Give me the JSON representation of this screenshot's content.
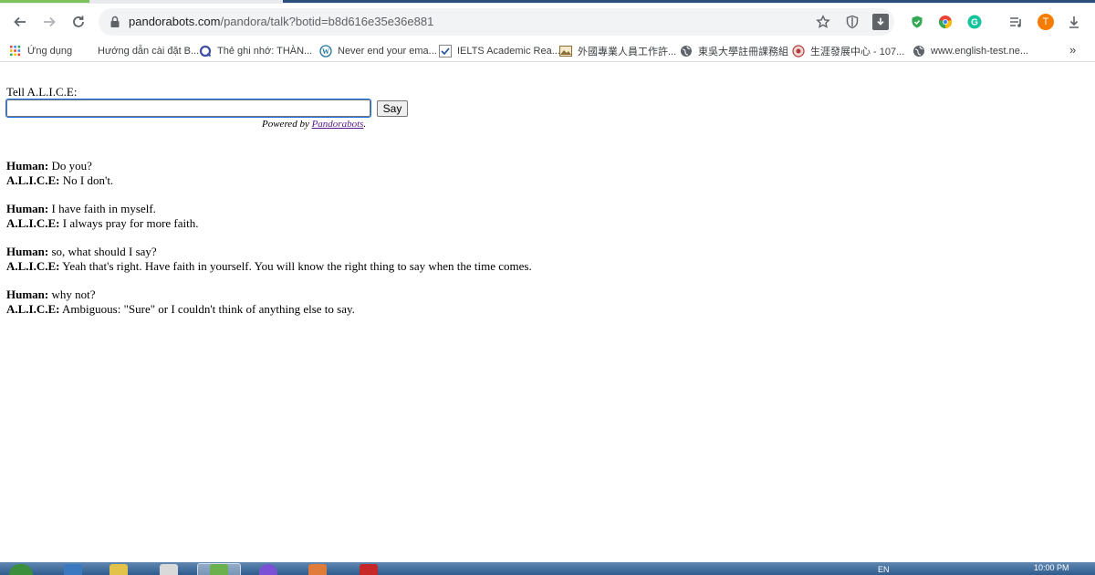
{
  "browser": {
    "url_host": "pandorabots.com",
    "url_path": "/pandora/talk?botid=b8d616e35e36e881",
    "avatar_letter": "T"
  },
  "bookmarks": [
    {
      "label": "Ứng dụng",
      "icon": "apps-grid-icon"
    },
    {
      "label": "Hướng dẫn cài đặt B...",
      "icon": "blank-icon"
    },
    {
      "label": "Thẻ ghi nhớ: THÀN...",
      "icon": "quizlet-icon"
    },
    {
      "label": "Never end your ema...",
      "icon": "wordpress-icon"
    },
    {
      "label": "IELTS Academic Rea...",
      "icon": "check-icon"
    },
    {
      "label": "外國專業人員工作許...",
      "icon": "image-icon"
    },
    {
      "label": "東吳大學註冊課務組",
      "icon": "globe-icon"
    },
    {
      "label": "生涯發展中心 - 107...",
      "icon": "seal-icon"
    },
    {
      "label": "www.english-test.ne...",
      "icon": "globe-icon"
    }
  ],
  "page": {
    "tell_label": "Tell A.L.I.C.E:",
    "input_value": "",
    "say_button": "Say",
    "powered_prefix": "Powered by ",
    "powered_link": "Pandorabots",
    "powered_suffix": "."
  },
  "conversation": [
    {
      "human_label": "Human:",
      "human_text": " Do you?",
      "bot_label": "A.L.I.C.E:",
      "bot_text": " No I don't."
    },
    {
      "human_label": "Human:",
      "human_text": " I have faith in myself.",
      "bot_label": "A.L.I.C.E:",
      "bot_text": " I always pray for more faith."
    },
    {
      "human_label": "Human:",
      "human_text": " so, what should I say?",
      "bot_label": "A.L.I.C.E:",
      "bot_text": " Yeah that's right. Have faith in yourself. You will know the right thing to say when the time comes."
    },
    {
      "human_label": "Human:",
      "human_text": " why not?",
      "bot_label": "A.L.I.C.E:",
      "bot_text": " Ambiguous: \"Sure\" or I couldn't think of anything else to say."
    }
  ],
  "taskbar": {
    "language": "EN",
    "time": "10:00 PM"
  },
  "colors": {
    "link_visited": "#551a8b",
    "focus_ring": "#1a73e8",
    "taskbar": "#2f5c8e"
  }
}
